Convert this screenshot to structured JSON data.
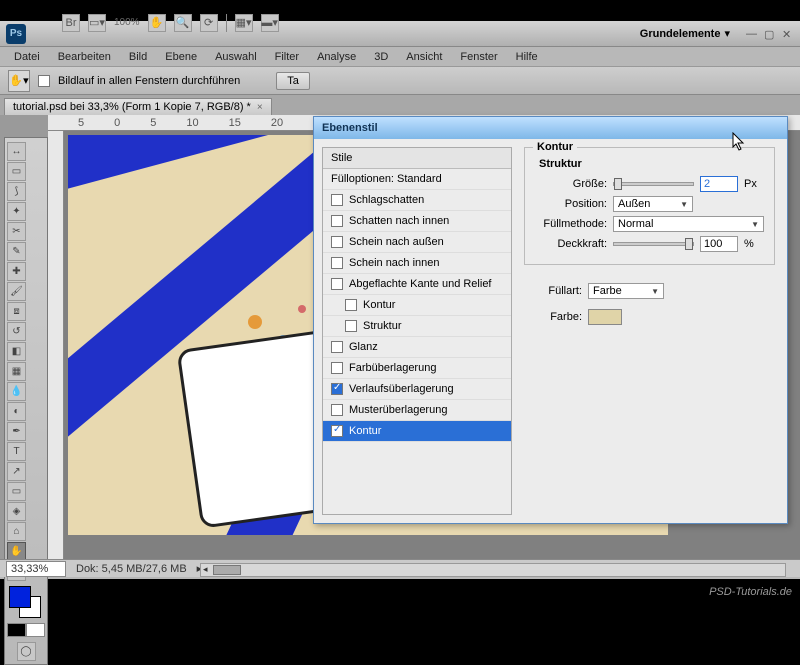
{
  "window": {
    "workspace": "Grundelemente"
  },
  "menu": [
    "Datei",
    "Bearbeiten",
    "Bild",
    "Ebene",
    "Auswahl",
    "Filter",
    "Analyse",
    "3D",
    "Ansicht",
    "Fenster",
    "Hilfe"
  ],
  "optionsbar": {
    "scroll_all": "Bildlauf in allen Fenstern durchführen",
    "actual_btn": "Ta"
  },
  "zoom_display": "100%",
  "doc_tab": {
    "title": "tutorial.psd bei 33,3% (Form 1 Kopie 7, RGB/8) *"
  },
  "ruler_marks": [
    "5",
    "0",
    "5",
    "10",
    "15",
    "20"
  ],
  "status": {
    "zoom": "33,33%",
    "doc": "Dok: 5,45 MB/27,6 MB"
  },
  "dialog": {
    "title": "Ebenenstil",
    "list_header": "Stile",
    "blend_opts": "Fülloptionen: Standard",
    "items": [
      {
        "label": "Schlagschatten",
        "checked": false
      },
      {
        "label": "Schatten nach innen",
        "checked": false
      },
      {
        "label": "Schein nach außen",
        "checked": false
      },
      {
        "label": "Schein nach innen",
        "checked": false
      },
      {
        "label": "Abgeflachte Kante und Relief",
        "checked": false
      },
      {
        "label": "Kontur",
        "checked": false,
        "indent": true
      },
      {
        "label": "Struktur",
        "checked": false,
        "indent": true
      },
      {
        "label": "Glanz",
        "checked": false
      },
      {
        "label": "Farbüberlagerung",
        "checked": false
      },
      {
        "label": "Verlaufsüberlagerung",
        "checked": true
      },
      {
        "label": "Musterüberlagerung",
        "checked": false
      },
      {
        "label": "Kontur",
        "checked": true,
        "selected": true
      }
    ],
    "panel": {
      "section": "Kontur",
      "subsection": "Struktur",
      "size_label": "Größe:",
      "size_value": "2",
      "size_unit": "Px",
      "pos_label": "Position:",
      "pos_value": "Außen",
      "blend_label": "Füllmethode:",
      "blend_value": "Normal",
      "opacity_label": "Deckkraft:",
      "opacity_value": "100",
      "opacity_unit": "%",
      "filltype_label": "Füllart:",
      "filltype_value": "Farbe",
      "color_label": "Farbe:",
      "color_hex": "#e0d4a8"
    }
  },
  "colors": {
    "fg": "#0022dd",
    "bg": "#ffffff",
    "canvas_bg": "#e8d9b0",
    "ray": "#2030c8"
  },
  "watermark": "PSD-Tutorials.de"
}
